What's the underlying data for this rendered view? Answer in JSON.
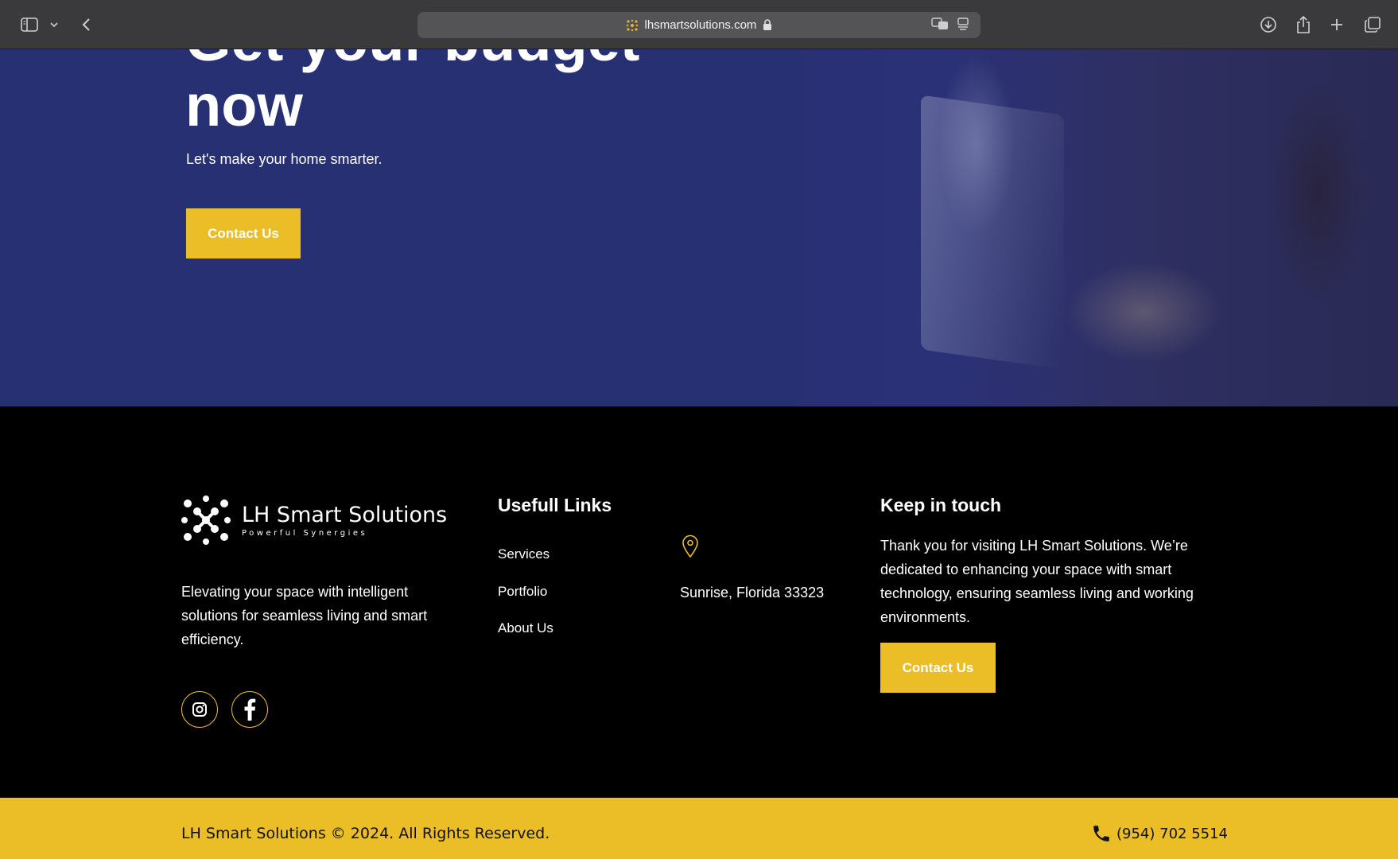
{
  "browser": {
    "url": "lhsmartsolutions.com"
  },
  "hero": {
    "heading_partial": "Get your budget",
    "heading_line2": "now",
    "subtitle": "Let's make your home smarter.",
    "cta_label": "Contact Us"
  },
  "footer": {
    "logo": {
      "title": "LH Smart Solutions",
      "tagline": "Powerful Synergies"
    },
    "about_text": "Elevating your space with intelligent solutions for seamless living and smart efficiency.",
    "social": [
      "instagram-icon",
      "facebook-icon"
    ],
    "links_heading": "Usefull Links",
    "links": [
      "Services",
      "Portfolio",
      "About Us"
    ],
    "address": "Sunrise, Florida 33323",
    "keep_heading": "Keep in touch",
    "keep_text": "Thank you for visiting LH Smart Solutions. We’re dedicated to enhancing your space with smart technology, ensuring seamless living and working environments.",
    "cta_label": "Contact Us"
  },
  "bottom": {
    "copyright": "LH Smart Solutions © 2024. All Rights Reserved.",
    "phone": "(954) 702 5514"
  },
  "colors": {
    "hero_bg": "#283074",
    "accent": "#ebbd27",
    "footer_bg": "#000000"
  }
}
